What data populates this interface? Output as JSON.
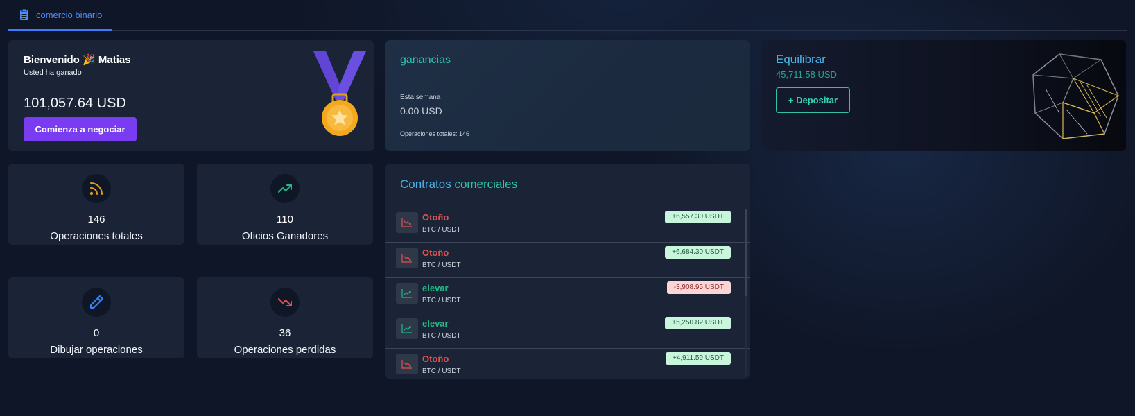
{
  "tabs": [
    {
      "label": "comercio binario",
      "icon": "clipboard-icon",
      "active": true
    }
  ],
  "welcome": {
    "greeting": "Bienvenido 🎉 Matias",
    "subtitle": "Usted ha ganado",
    "amount": "101,057.64 USD",
    "cta_label": "Comienza a negociar"
  },
  "earnings": {
    "title": "ganancias",
    "week_label": "Esta semana",
    "week_value": "0.00 USD",
    "total_ops": "Operaciones totales: 146"
  },
  "balance": {
    "title": "Equilibrar",
    "value": "45,711.58  USD",
    "deposit_label": "+ Depositar"
  },
  "stats": {
    "total": {
      "value": "146",
      "label": "Operaciones totales",
      "icon": "rss-icon"
    },
    "win": {
      "value": "110",
      "label": "Oficios Ganadores",
      "icon": "trend-up-icon"
    },
    "draw": {
      "value": "0",
      "label": "Dibujar operaciones",
      "icon": "pencil-icon"
    },
    "lost": {
      "value": "36",
      "label": "Operaciones perdidas",
      "icon": "trend-down-icon"
    }
  },
  "contracts": {
    "title_part1": "Contratos ",
    "title_part2": "comerciales",
    "rows": [
      {
        "direction": "Otoño",
        "type": "down",
        "pair": "BTC / USDT",
        "amount": "+6,557.30  USDT",
        "positive": true
      },
      {
        "direction": "Otoño",
        "type": "down",
        "pair": "BTC / USDT",
        "amount": "+6,684.30  USDT",
        "positive": true
      },
      {
        "direction": "elevar",
        "type": "up",
        "pair": "BTC / USDT",
        "amount": "-3,908.95  USDT",
        "positive": false
      },
      {
        "direction": "elevar",
        "type": "up",
        "pair": "BTC / USDT",
        "amount": "+5,250.82  USDT",
        "positive": true
      },
      {
        "direction": "Otoño",
        "type": "down",
        "pair": "BTC / USDT",
        "amount": "+4,911.59  USDT",
        "positive": true
      }
    ]
  },
  "colors": {
    "accent_purple": "#7a3cf0",
    "accent_teal": "#2fc2a8",
    "accent_blue": "#4ab3e8",
    "loss_red": "#e05252",
    "gain_green": "#23b98a"
  }
}
